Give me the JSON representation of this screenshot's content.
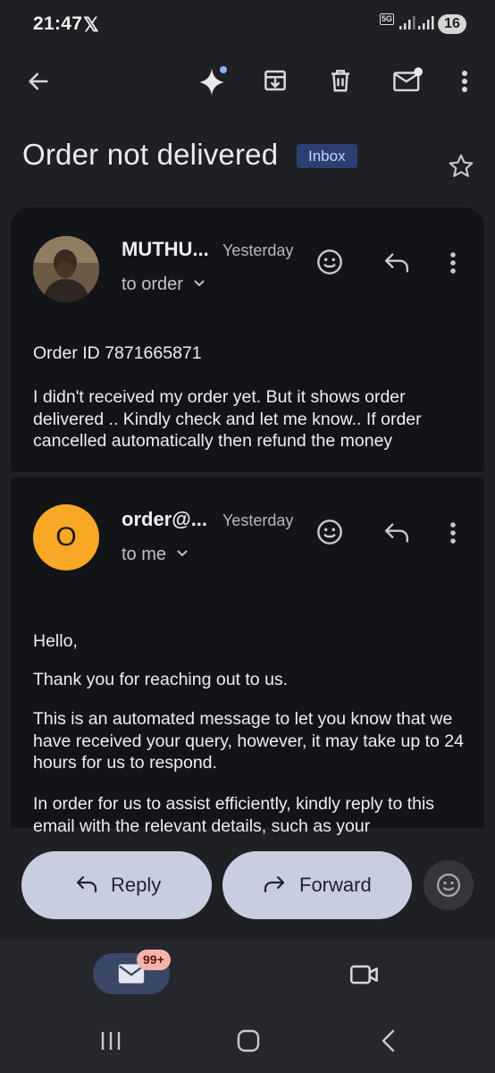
{
  "status_bar": {
    "time": "21:47",
    "x_logo": "𝕏",
    "network": "5G",
    "battery": "16",
    "icons": [
      "signal-icon",
      "signal-icon"
    ]
  },
  "toolbar": {
    "icons": [
      "back-arrow-icon",
      "gemini-sparkle-icon",
      "archive-icon",
      "delete-icon",
      "mark-unread-icon",
      "more-vert-icon"
    ]
  },
  "email": {
    "subject": "Order not delivered",
    "label": "Inbox"
  },
  "messages": [
    {
      "sender": "MUTHU...",
      "time": "Yesterday",
      "recipient": "to order",
      "body": [
        "Order ID 7871665871",
        "I didn't received my order yet. But it shows order delivered .. Kindly check and let me know.. If order cancelled automatically then refund the money"
      ]
    },
    {
      "sender": "order@...",
      "time": "Yesterday",
      "recipient": "to me",
      "avatar_letter": "O",
      "avatar_color": "#f9a825",
      "body": [
        "Hello,",
        "Thank you for reaching out to us.",
        "This is an automated message to let you know that we have received your query, however, it may take up to 24 hours for us to respond.",
        "In order for us to assist efficiently, kindly reply to this email with the relevant details, such as your"
      ]
    }
  ],
  "actions": {
    "reply": "Reply",
    "forward": "Forward"
  },
  "bottom_nav": {
    "mail_badge": "99+",
    "items": [
      "mail-icon",
      "video-camera-icon"
    ]
  },
  "system_nav": [
    "recents-icon",
    "home-icon",
    "back-icon"
  ],
  "colors": {
    "background": "#1f2024",
    "card": "#131417",
    "inbox_chip": "#2c3f73",
    "action_pill": "#c9cde0",
    "badge": "#f5b5ad",
    "accent_dot": "#8ab4f8"
  }
}
